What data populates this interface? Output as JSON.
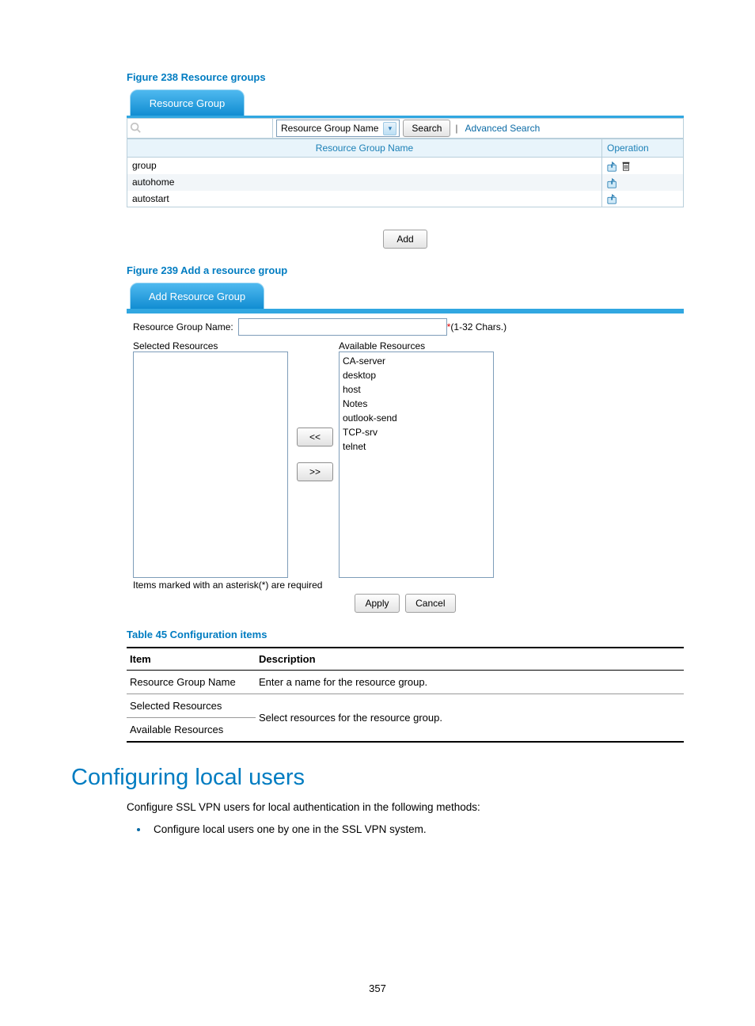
{
  "fig238": {
    "caption": "Figure 238 Resource groups",
    "tab": "Resource Group",
    "search_placeholder": "",
    "dropdown": "Resource Group Name",
    "search_btn": "Search",
    "advanced": "Advanced Search",
    "col_name": "Resource Group Name",
    "col_op": "Operation",
    "rows": [
      {
        "name": "group",
        "configurable": true,
        "deletable": true
      },
      {
        "name": "autohome",
        "configurable": true,
        "deletable": false
      },
      {
        "name": "autostart",
        "configurable": true,
        "deletable": false
      }
    ],
    "add_btn": "Add"
  },
  "fig239": {
    "caption": "Figure 239 Add a resource group",
    "tab": "Add Resource Group",
    "name_label": "Resource Group Name:",
    "name_value": "",
    "hint": "(1-32 Chars.)",
    "selected_label": "Selected Resources",
    "available_label": "Available Resources",
    "selected": [],
    "available": [
      "CA-server",
      "desktop",
      "host",
      "Notes",
      "outlook-send",
      "TCP-srv",
      "telnet"
    ],
    "move_left": "<<",
    "move_right": ">>",
    "note": "Items marked with an asterisk(*) are required",
    "apply": "Apply",
    "cancel": "Cancel"
  },
  "table45": {
    "caption": "Table 45 Configuration items",
    "head_item": "Item",
    "head_desc": "Description",
    "rows": [
      {
        "item": "Resource Group Name",
        "desc": "Enter a name for the resource group."
      },
      {
        "item": "Selected Resources",
        "desc": "Select resources for the resource group.",
        "rowspan_start": true
      },
      {
        "item": "Available Resources",
        "desc": "",
        "merged": true
      }
    ]
  },
  "section_heading": "Configuring local users",
  "intro": "Configure SSL VPN users for local authentication in the following methods:",
  "bullets": [
    "Configure local users one by one in the SSL VPN system."
  ],
  "page_number": "357"
}
